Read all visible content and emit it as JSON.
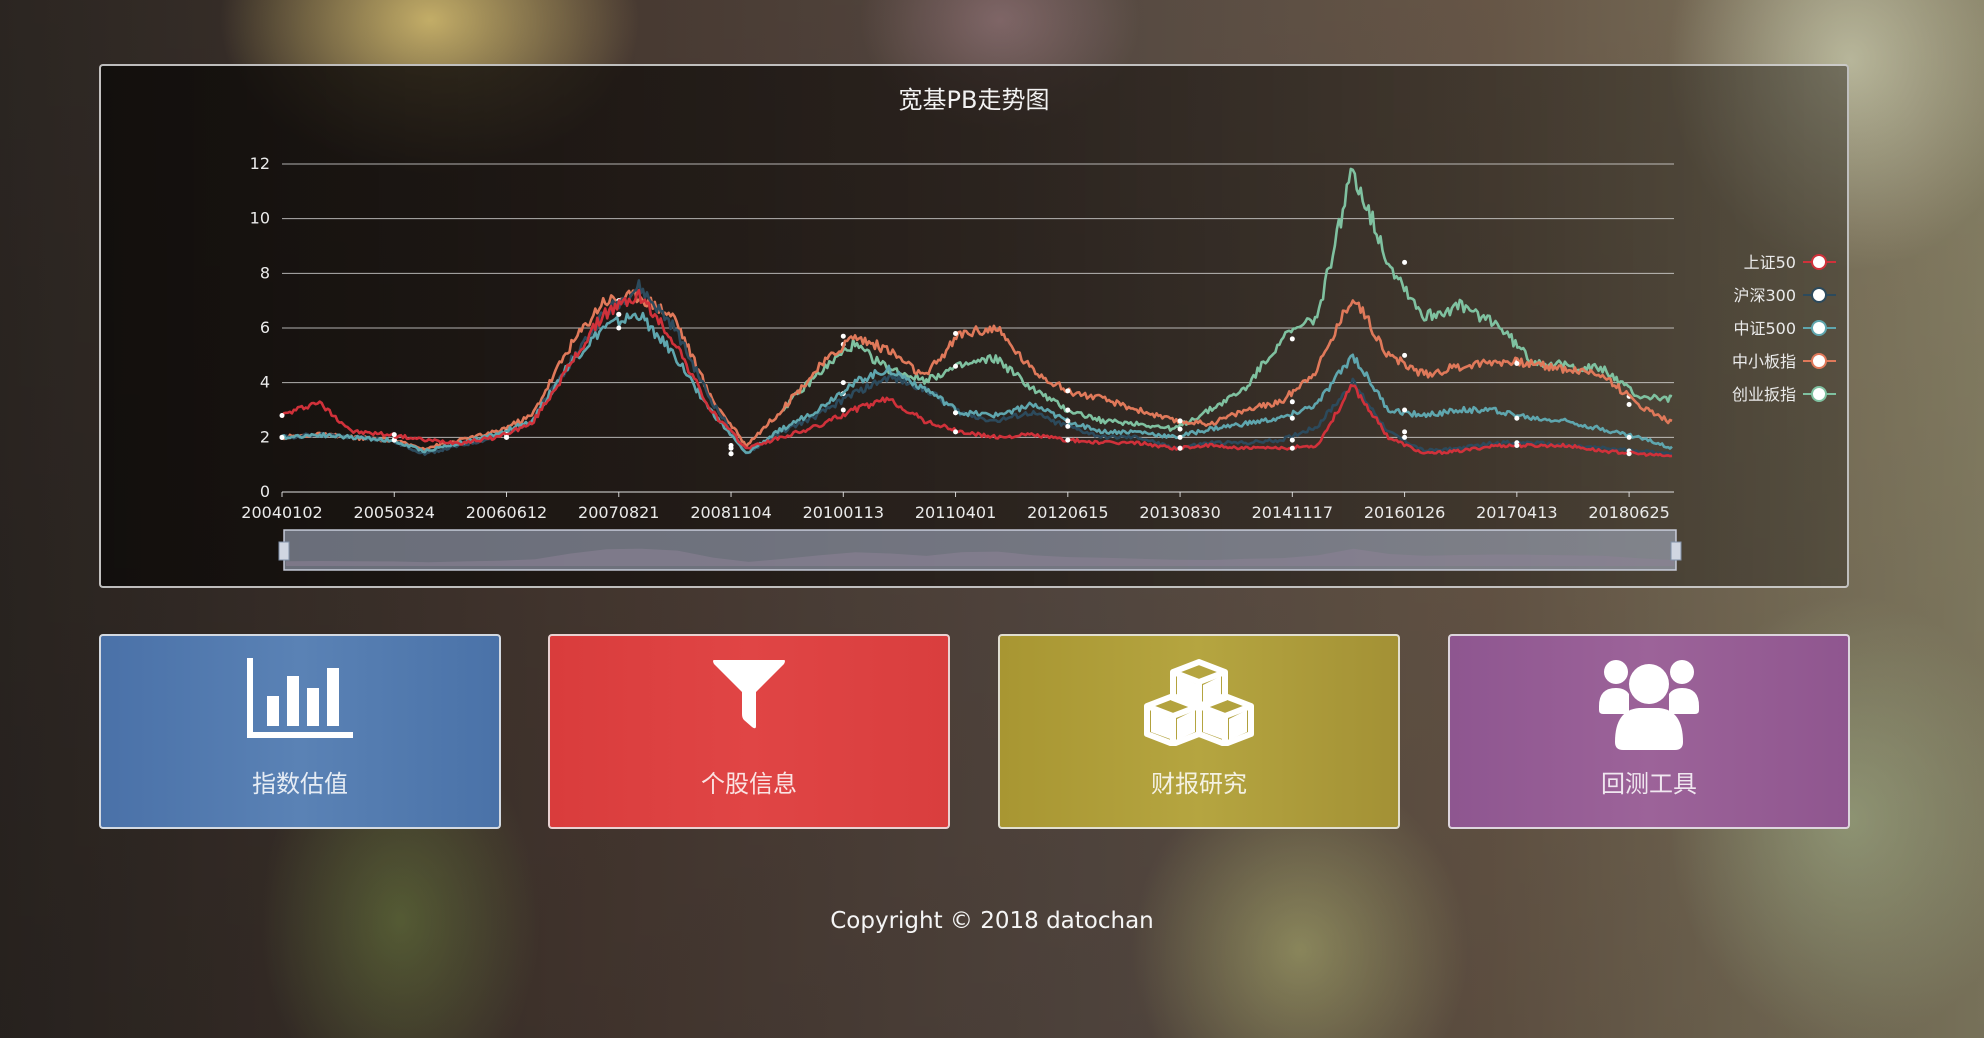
{
  "chart": {
    "title": "宽基PB走势图"
  },
  "chart_data": {
    "type": "line",
    "title": "宽基PB走势图",
    "ylim": [
      0,
      12
    ],
    "yticks": [
      0,
      2,
      4,
      6,
      8,
      10,
      12
    ],
    "xticks": [
      "20040102",
      "20050324",
      "20060612",
      "20070821",
      "20081104",
      "20100113",
      "20110401",
      "20120615",
      "20130830",
      "20141117",
      "20160126",
      "20170413",
      "20180625"
    ],
    "grid": true,
    "legend_position": "right",
    "series": [
      {
        "name": "上证50",
        "color": "#d0313a",
        "values": [
          2.8,
          3.3,
          2.2,
          2.1,
          1.9,
          1.8,
          2.0,
          2.5,
          4.5,
          6.5,
          7.2,
          5.5,
          3.0,
          1.6,
          2.0,
          2.4,
          3.0,
          3.4,
          2.6,
          2.2,
          2.0,
          2.1,
          1.9,
          1.8,
          1.8,
          1.6,
          1.7,
          1.6,
          1.6,
          1.7,
          3.9,
          2.0,
          1.4,
          1.5,
          1.7,
          1.7,
          1.7,
          1.5,
          1.4,
          1.3
        ]
      },
      {
        "name": "沪深300",
        "color": "#2c4a5c",
        "values": [
          2.0,
          2.1,
          2.0,
          1.9,
          1.4,
          1.7,
          2.0,
          2.6,
          4.6,
          6.5,
          7.5,
          6.0,
          3.4,
          1.4,
          2.2,
          2.8,
          3.6,
          4.2,
          3.8,
          2.9,
          2.6,
          2.9,
          2.4,
          2.0,
          2.0,
          1.6,
          1.8,
          1.8,
          1.9,
          2.4,
          4.0,
          2.2,
          1.5,
          1.6,
          1.8,
          1.8,
          1.7,
          1.6,
          1.5,
          1.4
        ]
      },
      {
        "name": "中证500",
        "color": "#5fa6ae",
        "values": [
          2.0,
          2.1,
          2.0,
          1.9,
          1.5,
          1.8,
          2.1,
          2.6,
          4.6,
          6.0,
          6.5,
          5.0,
          3.0,
          1.4,
          2.3,
          3.0,
          4.0,
          4.5,
          3.8,
          2.9,
          2.8,
          3.2,
          2.6,
          2.2,
          2.2,
          2.0,
          2.3,
          2.5,
          2.7,
          3.2,
          5.0,
          3.0,
          2.8,
          3.0,
          3.0,
          2.7,
          2.6,
          2.3,
          2.0,
          1.6
        ]
      },
      {
        "name": "中小板指",
        "color": "#e0795a",
        "values": [
          2.0,
          2.1,
          2.0,
          1.9,
          1.6,
          1.9,
          2.2,
          2.8,
          5.2,
          7.0,
          7.2,
          6.4,
          3.5,
          1.7,
          3.0,
          4.5,
          5.7,
          5.2,
          4.2,
          5.8,
          6.0,
          4.5,
          3.7,
          3.4,
          3.0,
          2.6,
          2.5,
          3.0,
          3.3,
          4.5,
          7.2,
          5.0,
          4.3,
          4.6,
          4.8,
          4.7,
          4.5,
          4.3,
          3.2,
          2.5
        ]
      },
      {
        "name": "创业扳指",
        "color": "#7fc1a0",
        "values": [
          null,
          null,
          null,
          null,
          null,
          null,
          null,
          null,
          null,
          null,
          null,
          null,
          null,
          null,
          3.0,
          4.3,
          5.4,
          4.5,
          4.1,
          4.6,
          4.9,
          3.8,
          3.0,
          2.6,
          2.5,
          2.3,
          3.0,
          3.8,
          5.6,
          6.4,
          11.8,
          8.4,
          6.4,
          6.8,
          6.2,
          4.8,
          4.6,
          4.5,
          3.5,
          3.4
        ]
      }
    ]
  },
  "tiles": [
    {
      "label": "指数估值",
      "icon": "bar-chart-icon",
      "color": "#4a72a8"
    },
    {
      "label": "个股信息",
      "icon": "filter-icon",
      "color": "#db3e3e"
    },
    {
      "label": "财报研究",
      "icon": "cubes-icon",
      "color": "#a89632"
    },
    {
      "label": "回测工具",
      "icon": "users-icon",
      "color": "#8f578f"
    }
  ],
  "footer": {
    "copyright": "Copyright © 2018 datochan"
  }
}
